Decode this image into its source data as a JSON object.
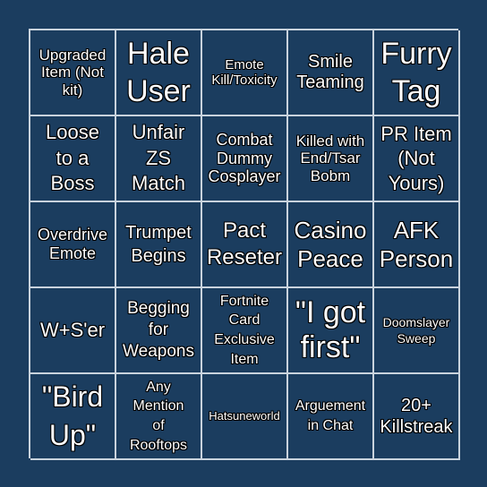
{
  "card": {
    "cells": [
      "Upgraded Item (Not kit)",
      "Hale User",
      "Emote Kill/Toxicity",
      "Smile Teaming",
      "Furry Tag",
      "Loose to a Boss",
      "Unfair ZS Match",
      "Combat Dummy Cosplayer",
      "Killed with End/Tsar Bobm",
      "PR Item (Not Yours)",
      "Overdrive Emote",
      "Trumpet Begins",
      "Pact Reseter",
      "Casino Peace",
      "AFK Person",
      "W+S'er",
      "Begging for Weapons",
      "Fortnite Card Exclusive Item",
      "\"I got first\"",
      "Doomslayer Sweep",
      "\"Bird Up\"",
      "Any Mention of Rooftops",
      "Hatsuneworld",
      "Arguement in Chat",
      "20+ Killstreak"
    ]
  },
  "colors": {
    "background": "#1b3d5f",
    "grid_line": "#c9d3dd",
    "text": "#ffffff"
  }
}
